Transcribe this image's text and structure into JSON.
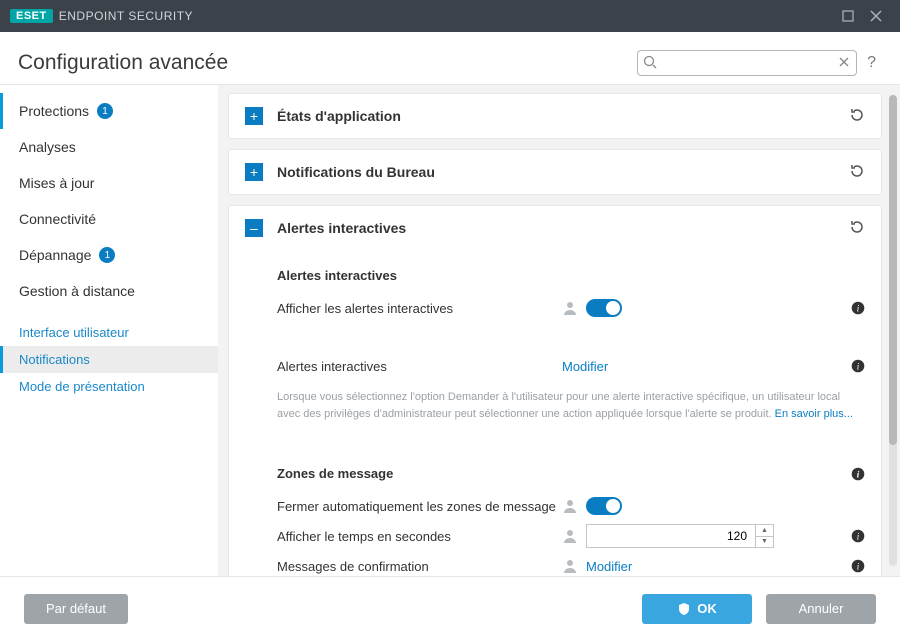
{
  "titlebar": {
    "brand": "ESET",
    "product": "ENDPOINT SECURITY"
  },
  "page_title": "Configuration avancée",
  "search": {
    "placeholder": ""
  },
  "sidebar": {
    "items": [
      {
        "label": "Protections",
        "badge": "1"
      },
      {
        "label": "Analyses"
      },
      {
        "label": "Mises à jour"
      },
      {
        "label": "Connectivité"
      },
      {
        "label": "Dépannage",
        "badge": "1"
      },
      {
        "label": "Gestion à distance"
      }
    ],
    "subitems": [
      {
        "label": "Interface utilisateur"
      },
      {
        "label": "Notifications"
      },
      {
        "label": "Mode de présentation"
      }
    ]
  },
  "panels": {
    "app_status": {
      "title": "États d'application"
    },
    "desktop_notif": {
      "title": "Notifications du Bureau"
    },
    "interactive": {
      "title": "Alertes interactives",
      "section1_title": "Alertes interactives",
      "row_show_alerts": "Afficher les alertes interactives",
      "row_alerts_label": "Alertes interactives",
      "row_alerts_action": "Modifier",
      "helptext": "Lorsque vous sélectionnez l'option Demander à l'utilisateur pour une alerte interactive spécifique, un utilisateur local avec des privilèges d'administrateur peut sélectionner une action appliquée lorsque l'alerte se produit. ",
      "helptext_link": "En savoir plus...",
      "section2_title": "Zones de message",
      "row_autoclose": "Fermer automatiquement les zones de message",
      "row_time": "Afficher le temps en secondes",
      "row_time_value": "120",
      "row_confirm": "Messages de confirmation",
      "row_confirm_action": "Modifier"
    }
  },
  "buttons": {
    "default": "Par défaut",
    "ok": "OK",
    "cancel": "Annuler"
  }
}
